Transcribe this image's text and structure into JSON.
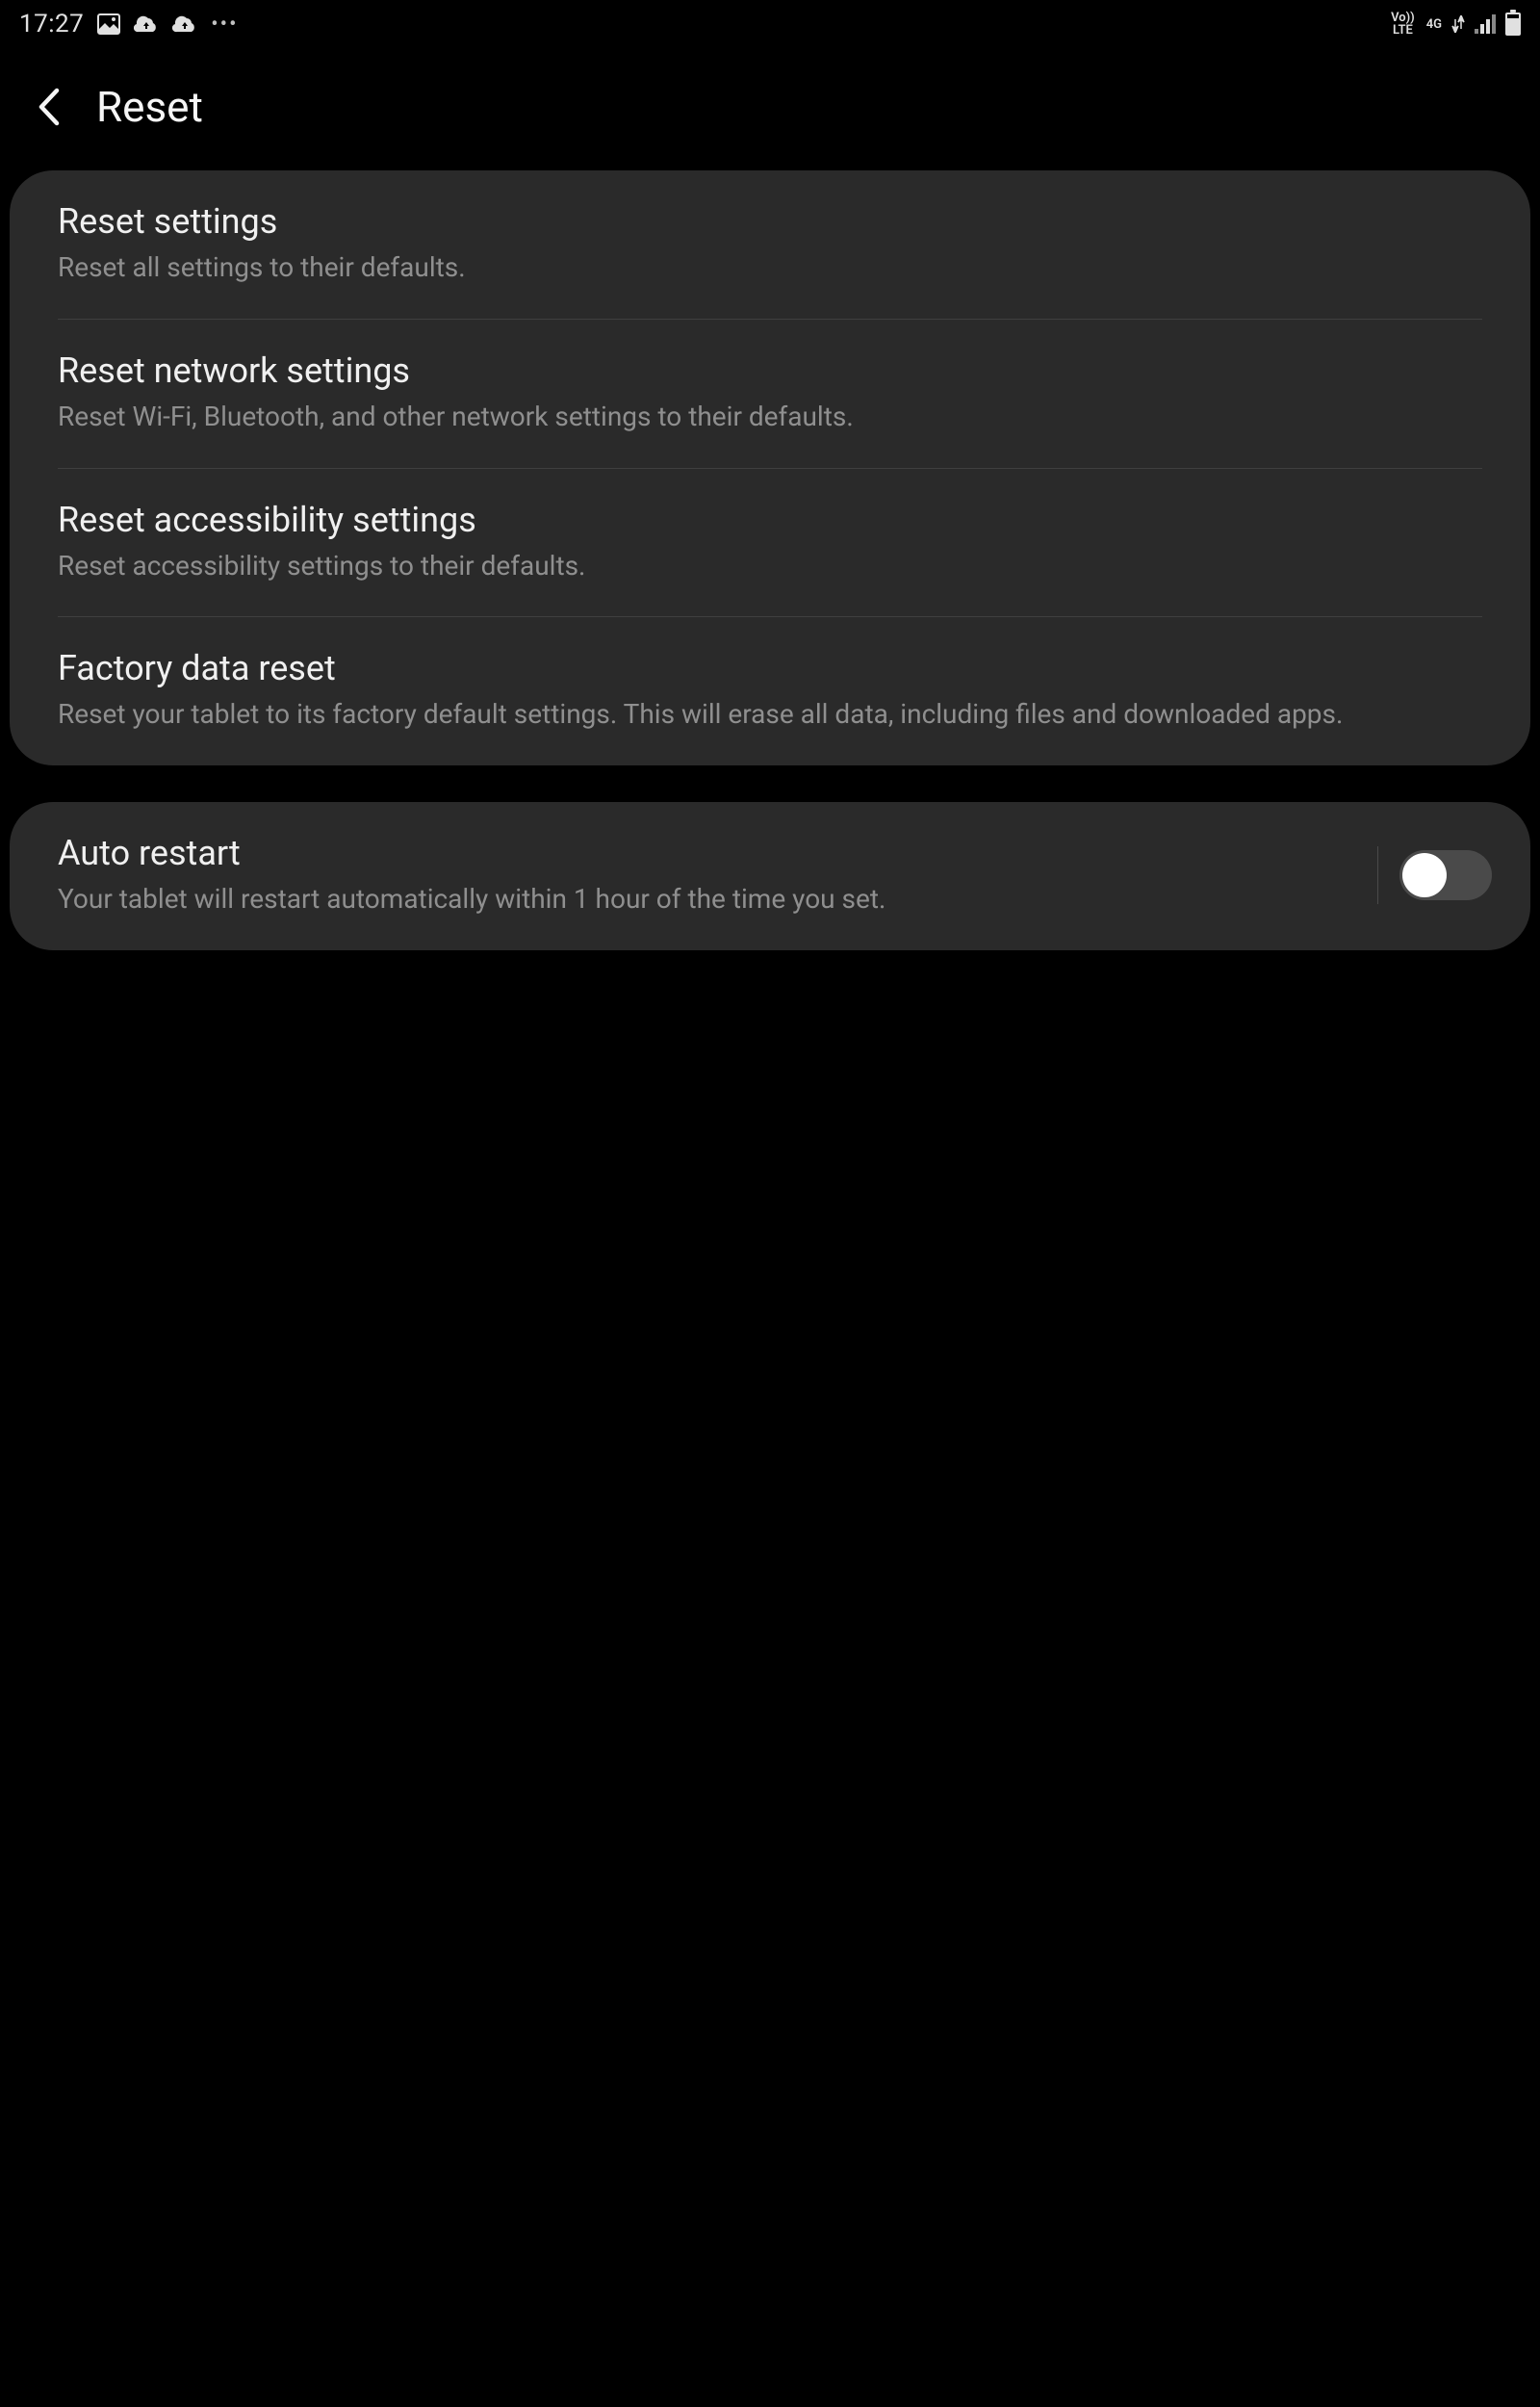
{
  "status_bar": {
    "time": "17:27",
    "volte": "Vo))\nLTE",
    "network": "4G"
  },
  "header": {
    "title": "Reset"
  },
  "main": {
    "items": [
      {
        "title": "Reset settings",
        "subtitle": "Reset all settings to their defaults."
      },
      {
        "title": "Reset network settings",
        "subtitle": "Reset Wi-Fi, Bluetooth, and other network settings to their defaults."
      },
      {
        "title": "Reset accessibility settings",
        "subtitle": "Reset accessibility settings to their defaults."
      },
      {
        "title": "Factory data reset",
        "subtitle": "Reset your tablet to its factory default settings. This will erase all data, including files and downloaded apps."
      }
    ]
  },
  "auto_restart": {
    "title": "Auto restart",
    "subtitle": "Your tablet will restart automatically within 1 hour of the time you set.",
    "enabled": false
  }
}
